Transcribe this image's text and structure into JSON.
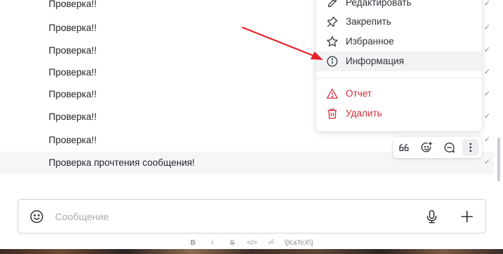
{
  "messages": [
    {
      "text": "Проверка!!",
      "status": "✓"
    },
    {
      "text": "Проверка!!",
      "status": "✓"
    },
    {
      "text": "Проверка!!",
      "status": "✓"
    },
    {
      "text": "Проверка!!",
      "status": "✓"
    },
    {
      "text": "Проверка!!",
      "status": "✓"
    },
    {
      "text": "Проверка!!",
      "status": "✓"
    },
    {
      "text": "Проверка!!",
      "status": "✓"
    },
    {
      "text": "Проверка прочтения сообщения!",
      "status": "✓"
    }
  ],
  "context_menu": {
    "items": [
      {
        "label": "Редактировать",
        "icon": "pencil-icon"
      },
      {
        "label": "Закрепить",
        "icon": "pin-icon"
      },
      {
        "label": "Избранное",
        "icon": "star-icon"
      },
      {
        "label": "Информация",
        "icon": "info-icon"
      }
    ],
    "danger_items": [
      {
        "label": "Отчет",
        "icon": "warning-icon"
      },
      {
        "label": "Удалить",
        "icon": "trash-icon"
      }
    ]
  },
  "message_actions": [
    {
      "name": "quote-icon"
    },
    {
      "name": "add-reaction-icon"
    },
    {
      "name": "reply-in-thread-icon"
    },
    {
      "name": "more-icon"
    }
  ],
  "composer": {
    "placeholder": "Сообщение"
  },
  "formatting_toolbar": {
    "bold": "B",
    "italic": "i",
    "strike": "S",
    "code": "</>",
    "enter": "⏎",
    "katex": "\\[KaTeX\\]"
  },
  "colors": {
    "accent": "#1d74f5",
    "danger": "#cc2b36",
    "arrow": "#e8222a"
  }
}
